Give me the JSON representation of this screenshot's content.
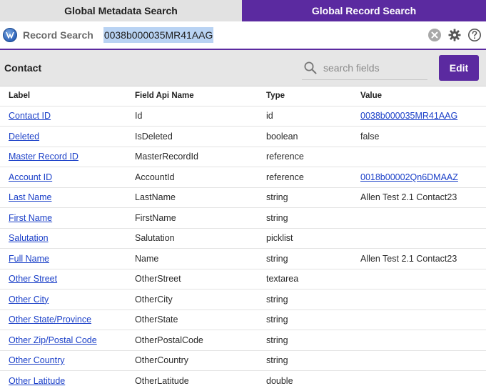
{
  "tabs": {
    "metadata": "Global Metadata Search",
    "record": "Global Record Search"
  },
  "search": {
    "label": "Record Search",
    "value": "0038b000035MR41AAG"
  },
  "header": {
    "title": "Contact",
    "field_search_placeholder": "search fields",
    "edit_label": "Edit"
  },
  "table": {
    "columns": [
      "Label",
      "Field Api Name",
      "Type",
      "Value"
    ],
    "rows": [
      {
        "label": "Contact ID",
        "api": "Id",
        "type": "id",
        "value": "0038b000035MR41AAG",
        "value_link": true
      },
      {
        "label": "Deleted",
        "api": "IsDeleted",
        "type": "boolean",
        "value": "false",
        "value_link": false
      },
      {
        "label": "Master Record ID",
        "api": "MasterRecordId",
        "type": "reference",
        "value": "",
        "value_link": false
      },
      {
        "label": "Account ID",
        "api": "AccountId",
        "type": "reference",
        "value": "0018b00002Qn6DMAAZ",
        "value_link": true
      },
      {
        "label": "Last Name",
        "api": "LastName",
        "type": "string",
        "value": "Allen Test 2.1 Contact23",
        "value_link": false
      },
      {
        "label": "First Name",
        "api": "FirstName",
        "type": "string",
        "value": "",
        "value_link": false
      },
      {
        "label": "Salutation",
        "api": "Salutation",
        "type": "picklist",
        "value": "",
        "value_link": false
      },
      {
        "label": "Full Name",
        "api": "Name",
        "type": "string",
        "value": "Allen Test 2.1 Contact23",
        "value_link": false
      },
      {
        "label": "Other Street",
        "api": "OtherStreet",
        "type": "textarea",
        "value": "",
        "value_link": false
      },
      {
        "label": "Other City",
        "api": "OtherCity",
        "type": "string",
        "value": "",
        "value_link": false
      },
      {
        "label": "Other State/Province",
        "api": "OtherState",
        "type": "string",
        "value": "",
        "value_link": false
      },
      {
        "label": "Other Zip/Postal Code",
        "api": "OtherPostalCode",
        "type": "string",
        "value": "",
        "value_link": false
      },
      {
        "label": "Other Country",
        "api": "OtherCountry",
        "type": "string",
        "value": "",
        "value_link": false
      },
      {
        "label": "Other Latitude",
        "api": "OtherLatitude",
        "type": "double",
        "value": "",
        "value_link": false
      }
    ]
  },
  "icons": {
    "logo": "globe-logo-icon",
    "clear": "clear-circle-icon",
    "settings": "gear-icon",
    "help": "help-icon",
    "field_search": "search-icon"
  },
  "colors": {
    "accent": "#5b2aa0",
    "link": "#1a3fc8",
    "selection": "#b9d3f3"
  }
}
